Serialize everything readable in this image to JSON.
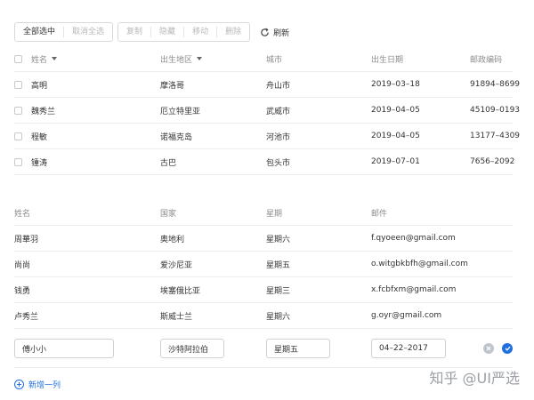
{
  "toolbar": {
    "select_all": "全部选中",
    "deselect_all": "取消全选",
    "copy": "复制",
    "hide": "隐藏",
    "move": "移动",
    "delete": "删除",
    "refresh": "刷新"
  },
  "table1": {
    "headers": {
      "name": "姓名",
      "birthplace": "出生地区",
      "city": "城市",
      "birthdate": "出生日期",
      "postcode": "邮政编码"
    },
    "rows": [
      {
        "name": "高明",
        "birthplace": "摩洛哥",
        "city": "舟山市",
        "birthdate": "2019–03–18",
        "postcode": "91894–8699"
      },
      {
        "name": "魏秀兰",
        "birthplace": "厄立特里亚",
        "city": "武威市",
        "birthdate": "2019–04–05",
        "postcode": "45109–0193"
      },
      {
        "name": "程敏",
        "birthplace": "诺福克岛",
        "city": "河池市",
        "birthdate": "2019–04–05",
        "postcode": "13177–4309"
      },
      {
        "name": "锺涛",
        "birthplace": "古巴",
        "city": "包头市",
        "birthdate": "2019–07–01",
        "postcode": "7656–2092"
      }
    ]
  },
  "table2": {
    "headers": {
      "name": "姓名",
      "country": "国家",
      "weekday": "星期",
      "email": "邮件"
    },
    "rows": [
      {
        "name": "周華羽",
        "country": "奥地利",
        "weekday": "星期六",
        "email": "f.qyoeen@gmail.com"
      },
      {
        "name": "尚尚",
        "country": "爱沙尼亚",
        "weekday": "星期五",
        "email": "o.witgbkbfh@gmail.com"
      },
      {
        "name": "钱勇",
        "country": "埃塞俄比亚",
        "weekday": "星期三",
        "email": "x.fcbfxm@gmail.com"
      },
      {
        "name": "卢秀兰",
        "country": "斯威士兰",
        "weekday": "星期六",
        "email": "g.oyr@gmail.com"
      }
    ],
    "edit_row": {
      "name": "傅小小",
      "country": "沙特阿拉伯",
      "weekday": "星期五",
      "date": "04–22–2017"
    },
    "add_column": "新增一列"
  },
  "watermark": "知乎 @UI严选",
  "colors": {
    "accent": "#1f6fe0",
    "border": "#ececec",
    "header_text": "#8c8c8c",
    "disabled_text": "#b8b8b8"
  }
}
